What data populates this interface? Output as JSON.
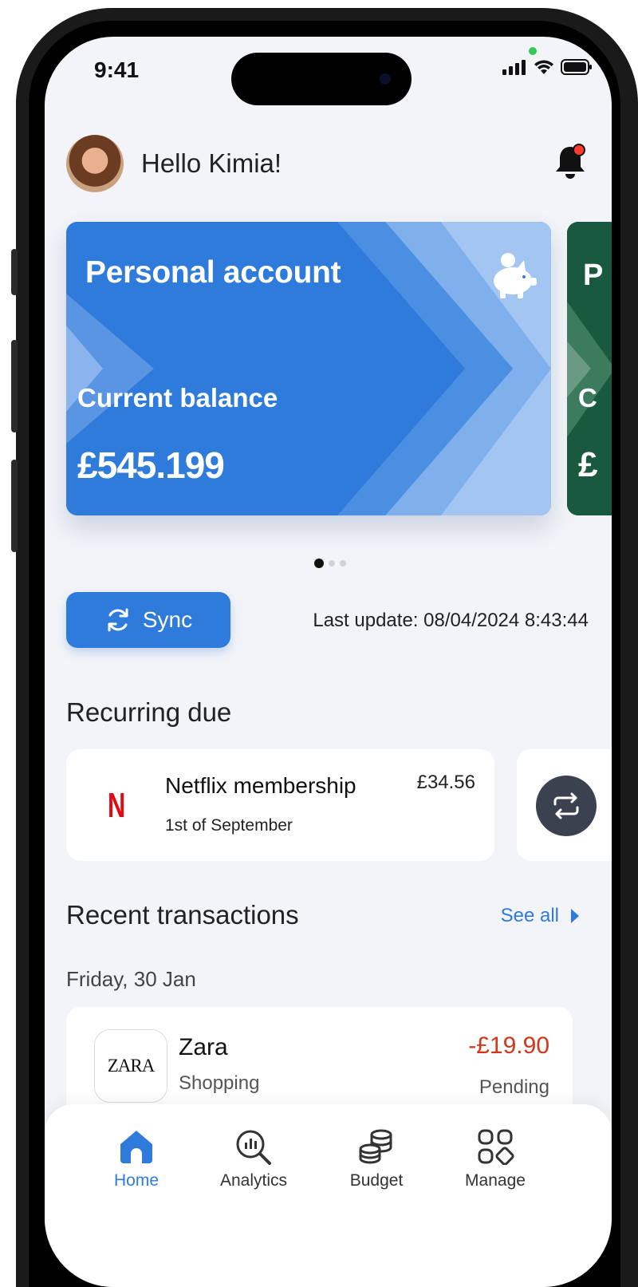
{
  "status_bar": {
    "time": "9:41"
  },
  "header": {
    "greeting": "Hello Kimia!"
  },
  "account_card": {
    "title": "Personal account",
    "balance_label": "Current balance",
    "balance": "£545.199",
    "next_card_letters": {
      "title": "P",
      "label": "C",
      "balance": "£"
    }
  },
  "carousel": {
    "page_count": 3,
    "active_index": 0
  },
  "sync": {
    "button_label": "Sync",
    "last_update": "Last update: 08/04/2024 8:43:44"
  },
  "recurring": {
    "title": "Recurring due",
    "item": {
      "name": "Netflix membership",
      "date": "1st of September",
      "amount": "£34.56",
      "logo_letter": "N"
    }
  },
  "transactions": {
    "title": "Recent transactions",
    "see_all": "See all",
    "date": "Friday, 30 Jan",
    "item": {
      "logo_text": "ZARA",
      "name": "Zara",
      "category": "Shopping",
      "amount": "-£19.90",
      "status": "Pending"
    }
  },
  "tabbar": {
    "items": [
      {
        "label": "Home",
        "icon": "home-icon",
        "active": true
      },
      {
        "label": "Analytics",
        "icon": "analytics-icon",
        "active": false
      },
      {
        "label": "Budget",
        "icon": "budget-icon",
        "active": false
      },
      {
        "label": "Manage",
        "icon": "manage-icon",
        "active": false
      }
    ]
  },
  "colors": {
    "accent": "#2f7bdb",
    "negative": "#d4361c",
    "next_card": "#195a3e",
    "notification": "#ff3b30"
  }
}
